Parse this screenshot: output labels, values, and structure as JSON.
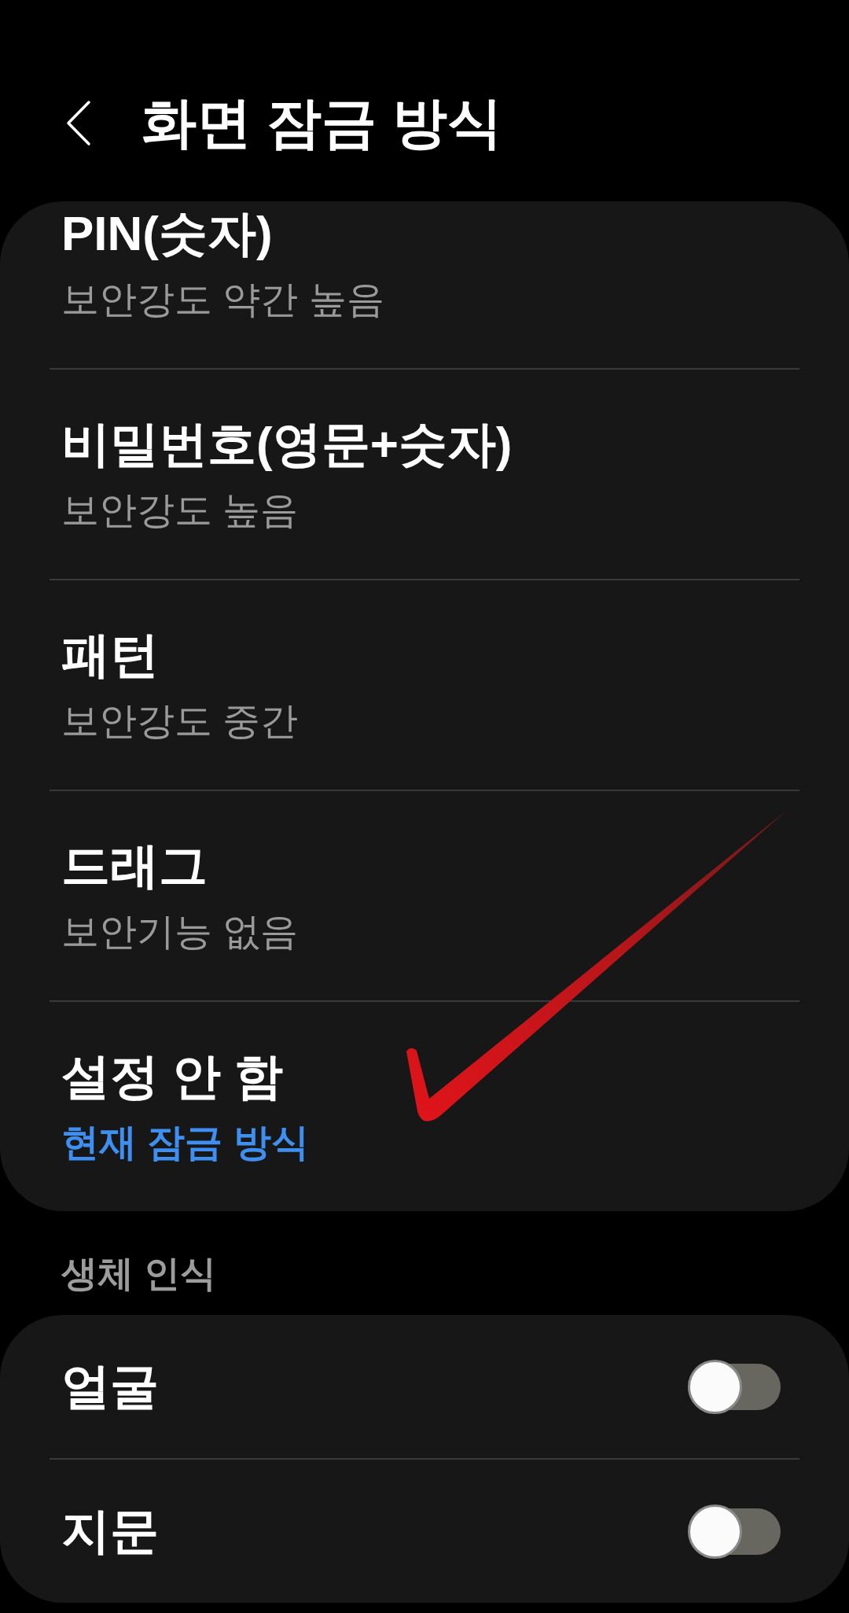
{
  "header": {
    "title": "화면 잠금 방식"
  },
  "lock_types": [
    {
      "title": "PIN(숫자)",
      "subtitle": "보안강도 약간 높음",
      "selected": false
    },
    {
      "title": "비밀번호(영문+숫자)",
      "subtitle": "보안강도 높음",
      "selected": false
    },
    {
      "title": "패턴",
      "subtitle": "보안강도 중간",
      "selected": false
    },
    {
      "title": "드래그",
      "subtitle": "보안기능 없음",
      "selected": false
    },
    {
      "title": "설정 안 함",
      "subtitle": "현재 잠금 방식",
      "selected": true
    }
  ],
  "biometrics": {
    "heading": "생체 인식",
    "items": [
      {
        "label": "얼굴",
        "on": false
      },
      {
        "label": "지문",
        "on": false
      }
    ]
  }
}
